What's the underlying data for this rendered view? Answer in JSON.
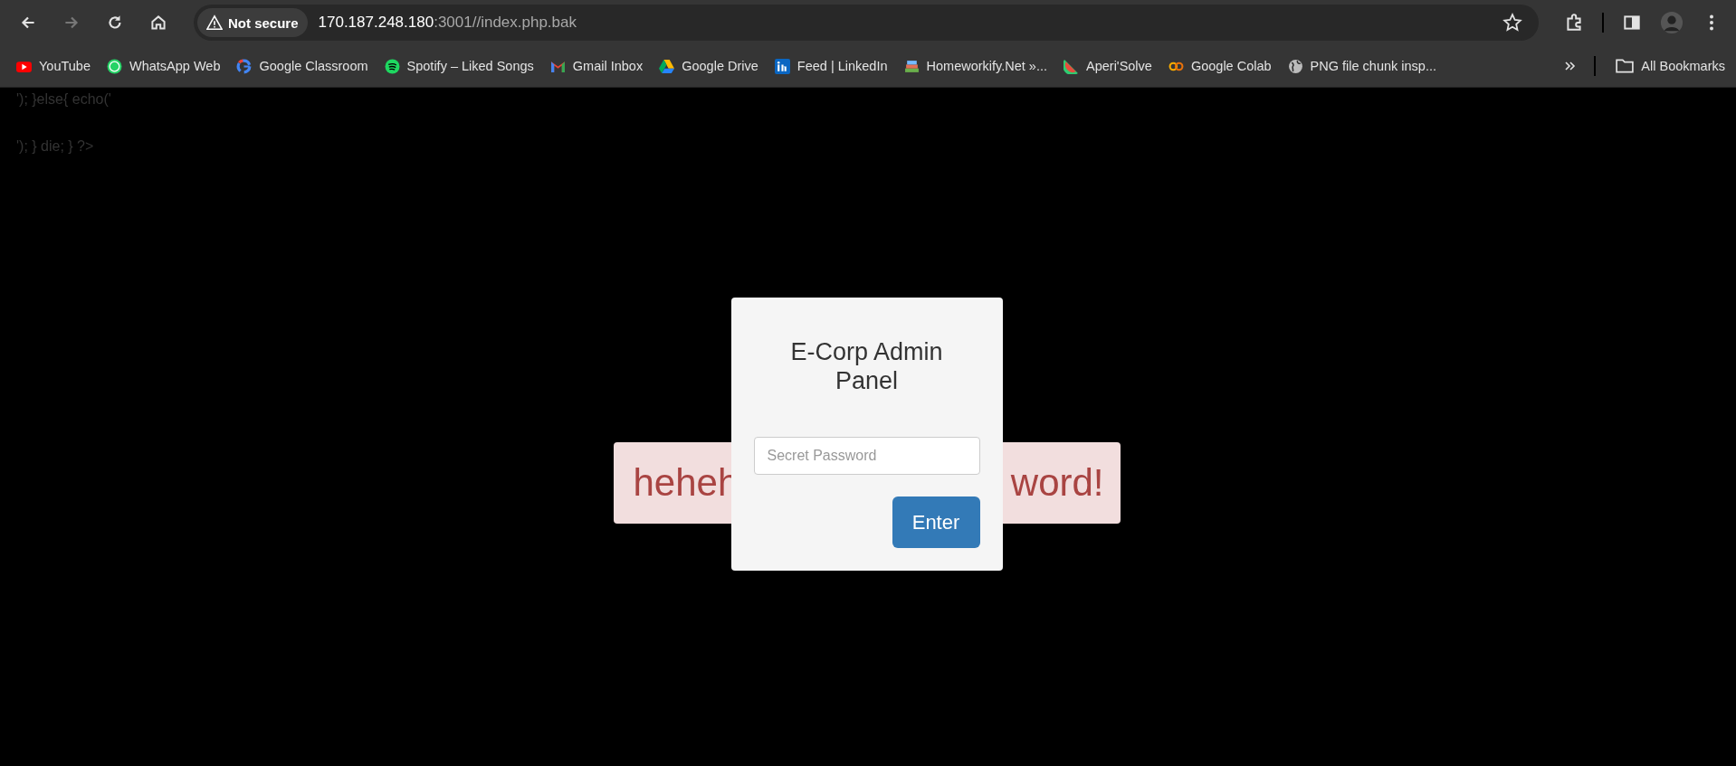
{
  "toolbar": {
    "security": "Not secure",
    "url_host": "170.187.248.180",
    "url_rest": ":3001//index.php.bak"
  },
  "bookmarks": [
    {
      "kind": "youtube",
      "label": "YouTube"
    },
    {
      "kind": "whatsapp",
      "label": "WhatsApp Web"
    },
    {
      "kind": "google",
      "label": "Google Classroom"
    },
    {
      "kind": "spotify",
      "label": "Spotify – Liked Songs"
    },
    {
      "kind": "gmail",
      "label": "Gmail Inbox"
    },
    {
      "kind": "drive",
      "label": "Google Drive"
    },
    {
      "kind": "linkedin",
      "label": "Feed | LinkedIn"
    },
    {
      "kind": "books",
      "label": "Homeworkify.Net »..."
    },
    {
      "kind": "melon",
      "label": "Aperi'Solve"
    },
    {
      "kind": "colab",
      "label": "Google Colab"
    },
    {
      "kind": "globe",
      "label": "PNG file chunk insp..."
    }
  ],
  "all_bookmarks": "All Bookmarks",
  "page": {
    "code_lines": [
      "'); }else{ echo('",
      "'); } die; } ?>"
    ],
    "alert": {
      "left": "heheh",
      "right": "word!"
    },
    "panel": {
      "title": "E-Corp Admin Panel",
      "password_placeholder": "Secret Password",
      "button": "Enter"
    }
  }
}
